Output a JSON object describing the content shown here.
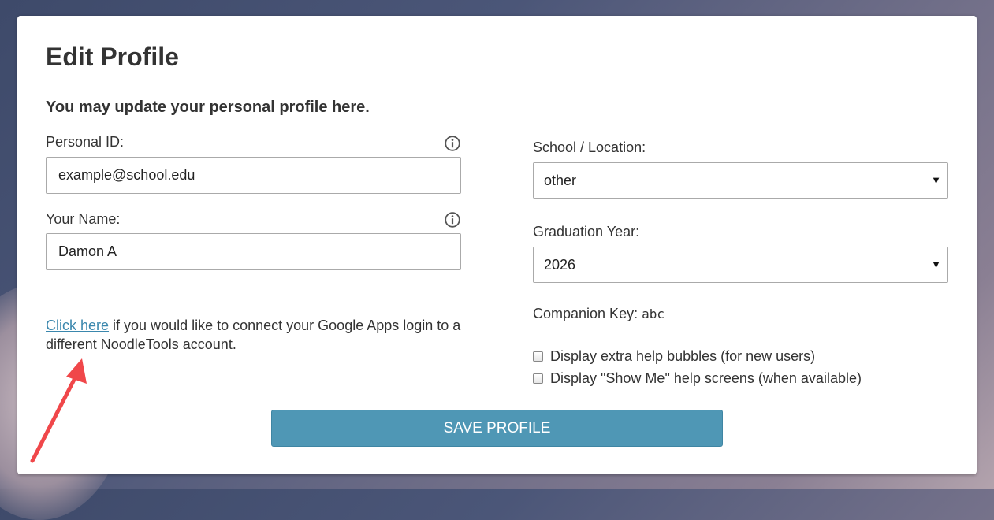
{
  "page": {
    "title": "Edit Profile",
    "subtitle": "You may update your personal profile here."
  },
  "personal_id": {
    "label": "Personal ID:",
    "value": "example@school.edu"
  },
  "your_name": {
    "label": "Your Name:",
    "value": "Damon A"
  },
  "google_link": {
    "link_text": "Click here",
    "rest_text": " if you would like to connect your Google Apps login to a different NoodleTools account."
  },
  "school": {
    "label": "School / Location:",
    "selected": "other"
  },
  "graduation": {
    "label": "Graduation Year:",
    "selected": "2026"
  },
  "companion_key": {
    "label": "Companion Key:",
    "value": "abc"
  },
  "options": [
    {
      "label": "Display extra help bubbles (for new users)",
      "checked": false
    },
    {
      "label": "Display \"Show Me\" help screens (when available)",
      "checked": false
    }
  ],
  "save_button": {
    "label": "SAVE PROFILE"
  },
  "colors": {
    "accent_button": "#4f97b5",
    "link": "#3a87ad",
    "annotation_arrow": "#f0474a"
  },
  "icons": {
    "info": "info-circle-icon",
    "caret": "caret-down-icon",
    "arrow": "red-annotation-arrow"
  }
}
